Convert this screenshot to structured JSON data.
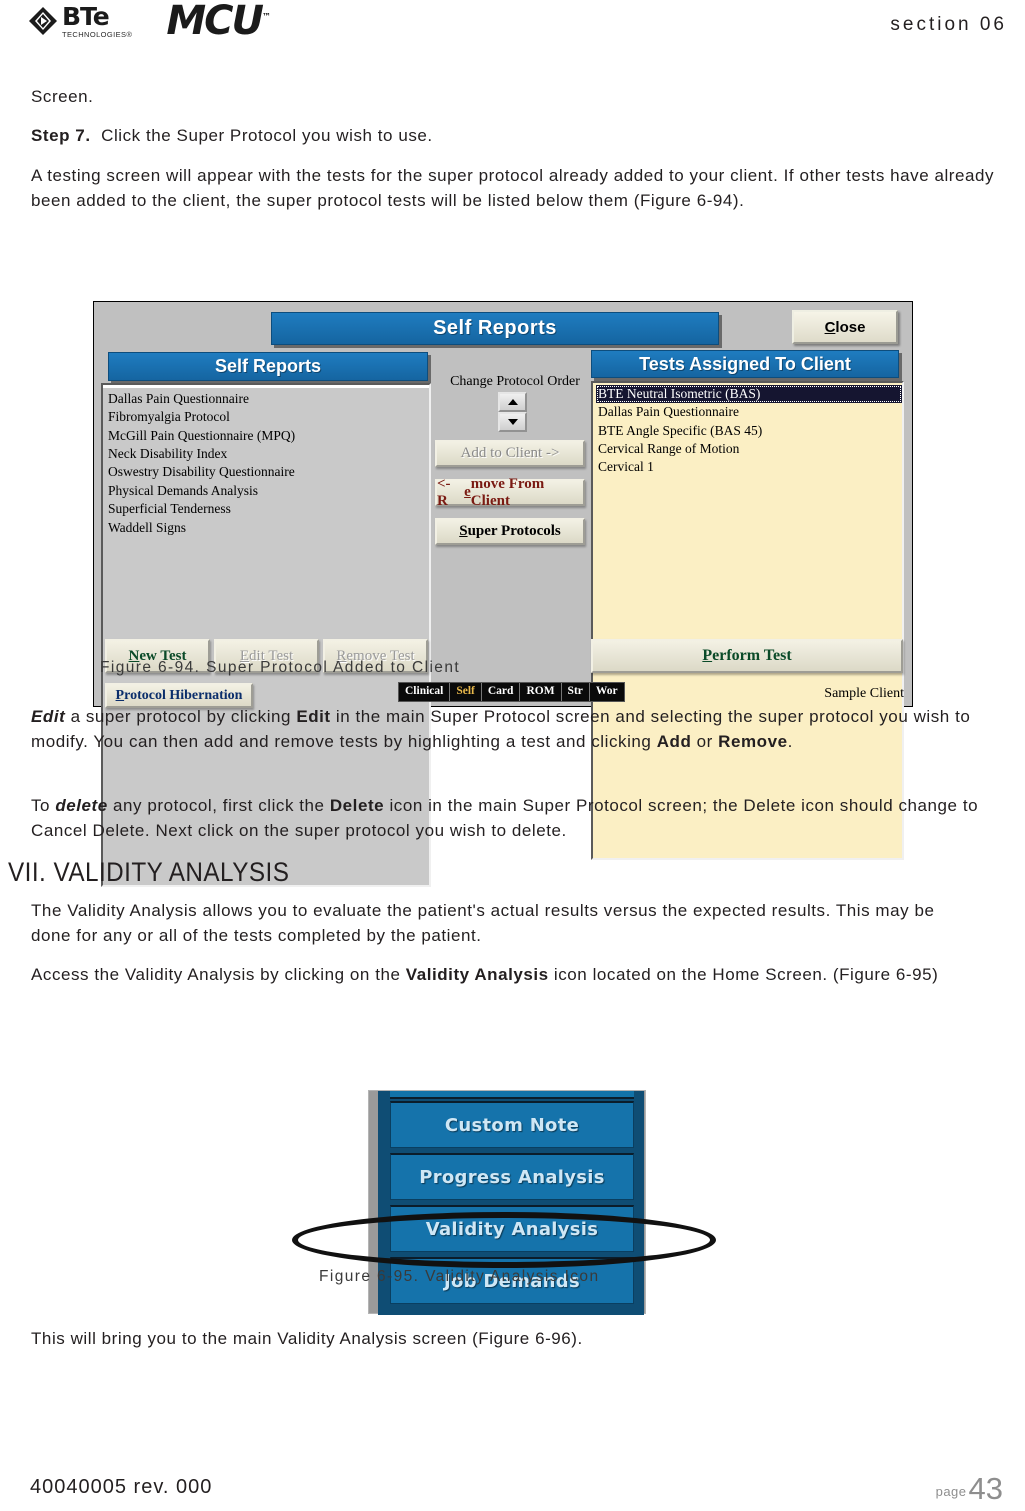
{
  "header": {
    "brand_name": "BTe",
    "brand_sub": "TECHNOLOGIES®",
    "product": "MCU",
    "product_tm": "™",
    "section": "section 06"
  },
  "body": {
    "p_screen": "Screen.",
    "step7_label": "Step 7.",
    "step7_text": "Click the Super Protocol you wish to use.",
    "p_testing_screen": "A testing screen will appear with the tests for the super protocol already added to your client. If other tests have already been added to the client, the super protocol tests will be listed below them (Figure 6-94).",
    "p_edit_1_emph": "Edit",
    "p_edit_2": " a super protocol by clicking ",
    "p_edit_3_strong": "Edit",
    "p_edit_4": " in the main Super Protocol screen and selecting the super protocol you wish to modify. You can then add and remove tests by highlighting a test and clicking ",
    "p_edit_5_strong": "Add",
    "p_edit_6": " or ",
    "p_edit_7_strong": "Remove",
    "p_edit_8": ".",
    "p_delete_1": "To ",
    "p_delete_2_emph": "delete",
    "p_delete_3": " any protocol, first click the ",
    "p_delete_4_strong": "Delete",
    "p_delete_5": " icon in the main Super Protocol screen; the Delete icon should change to Cancel Delete. Next click on the super protocol you wish to delete.",
    "section_heading": "VII. VALIDITY ANALYSIS",
    "p_validity_intro": "The Validity Analysis allows you to evaluate the patient's actual results versus the expected results. This may be done for any or all of the tests completed by the patient.",
    "p_access_1": "Access the Validity Analysis by clicking on the ",
    "p_access_2_strong": "Validity Analysis",
    "p_access_3": " icon located on the Home Screen. (Figure 6-95)",
    "p_bring_you": "This will bring you to the main Validity Analysis screen (Figure 6-96)."
  },
  "figure94": {
    "caption": "Figure 6-94. Super Protocol Added to Client",
    "title_bar": "Self Reports",
    "close_button": {
      "u": "C",
      "rest": "lose"
    },
    "left_panel_title": "Self Reports",
    "right_panel_title": "Tests Assigned To Client",
    "self_reports_list": [
      "Dallas Pain Questionnaire",
      "Fibromyalgia Protocol",
      "McGill Pain Questionnaire (MPQ)",
      "Neck Disability Index",
      "Oswestry Disability Questionnaire",
      "Physical Demands Analysis",
      "Superficial Tenderness",
      "Waddell Signs"
    ],
    "assigned_tests": [
      {
        "label": "BTE Neutral Isometric (BAS)",
        "selected": true
      },
      {
        "label": "Dallas Pain Questionnaire",
        "selected": false
      },
      {
        "label": "BTE  Angle Specific (BAS 45)",
        "selected": false
      },
      {
        "label": "Cervical Range of Motion",
        "selected": false
      },
      {
        "label": "Cervical  1",
        "selected": false
      }
    ],
    "change_protocol_order_label": "Change Protocol Order",
    "add_to_client_button": "Add to Client ->",
    "remove_from_client_button": {
      "pre": "<- R",
      "u": "e",
      "rest": "move From Client"
    },
    "super_protocols_button": {
      "u": "S",
      "rest": "uper Protocols"
    },
    "new_test_button": {
      "u": "N",
      "rest": "ew Test"
    },
    "edit_test_button": {
      "u": "E",
      "rest": "dit Test"
    },
    "remove_test_button": {
      "u": "R",
      "rest": "emove Test"
    },
    "perform_test_button": {
      "pre": "",
      "u": "P",
      "rest": "erform Test"
    },
    "protocol_hibernation_button": {
      "u": "P",
      "rest": "rotocol Hibernation"
    },
    "tabs": [
      {
        "label": "Clinical",
        "active": false
      },
      {
        "label": "Self",
        "active": true
      },
      {
        "label": "Card",
        "active": false
      },
      {
        "label": "ROM",
        "active": false
      },
      {
        "label": "Str",
        "active": false
      },
      {
        "label": "Wor",
        "active": false
      }
    ],
    "client_name": "Sample Client"
  },
  "figure95": {
    "caption": "Figure 6-95. Validity Analysis Icon",
    "buttons": [
      "Custom Note",
      "Progress Analysis",
      "Validity Analysis",
      "Job Demands"
    ],
    "highlighted_button": "Validity Analysis"
  },
  "footer": {
    "doc_number": "40040005 rev. 000",
    "page_word": "page",
    "page_number": "43"
  },
  "colors": {
    "brand_blue": "#1573ab",
    "window_gray": "#c0c0c0",
    "list_cream": "#fbefc4",
    "button_beige": "#ece9d8",
    "text_dark": "#231f20",
    "tab_active": "#e8b84b"
  }
}
